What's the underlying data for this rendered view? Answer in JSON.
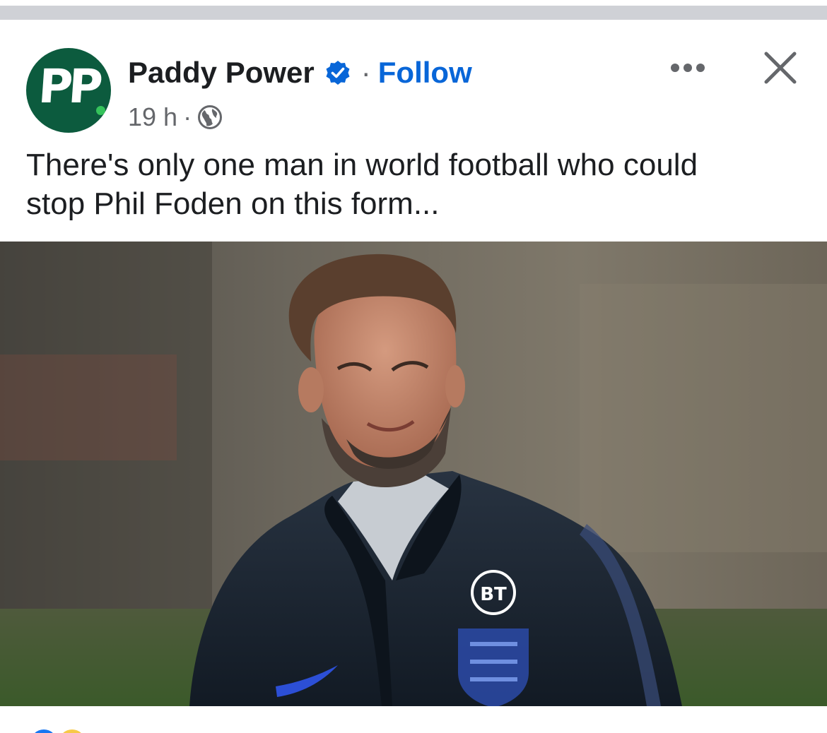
{
  "post": {
    "page_name": "Paddy Power",
    "avatar_text": "PP",
    "separator": "·",
    "follow_label": "Follow",
    "timestamp": "19 h",
    "meta_separator": "·",
    "privacy_icon": "globe-icon",
    "more_icon": "more-horizontal-icon",
    "close_icon": "close-icon",
    "verified_icon": "verified-badge-icon",
    "text_line_1": "There's only one man in world football who could",
    "text_line_2": "stop Phil Foden on this form...",
    "photo_badge_text": "BT"
  },
  "colors": {
    "brand_green": "#0c5b3e",
    "brand_dot": "#35c35b",
    "link_blue": "#0866d8",
    "text_primary": "#1c1e21",
    "text_secondary": "#65676b"
  }
}
